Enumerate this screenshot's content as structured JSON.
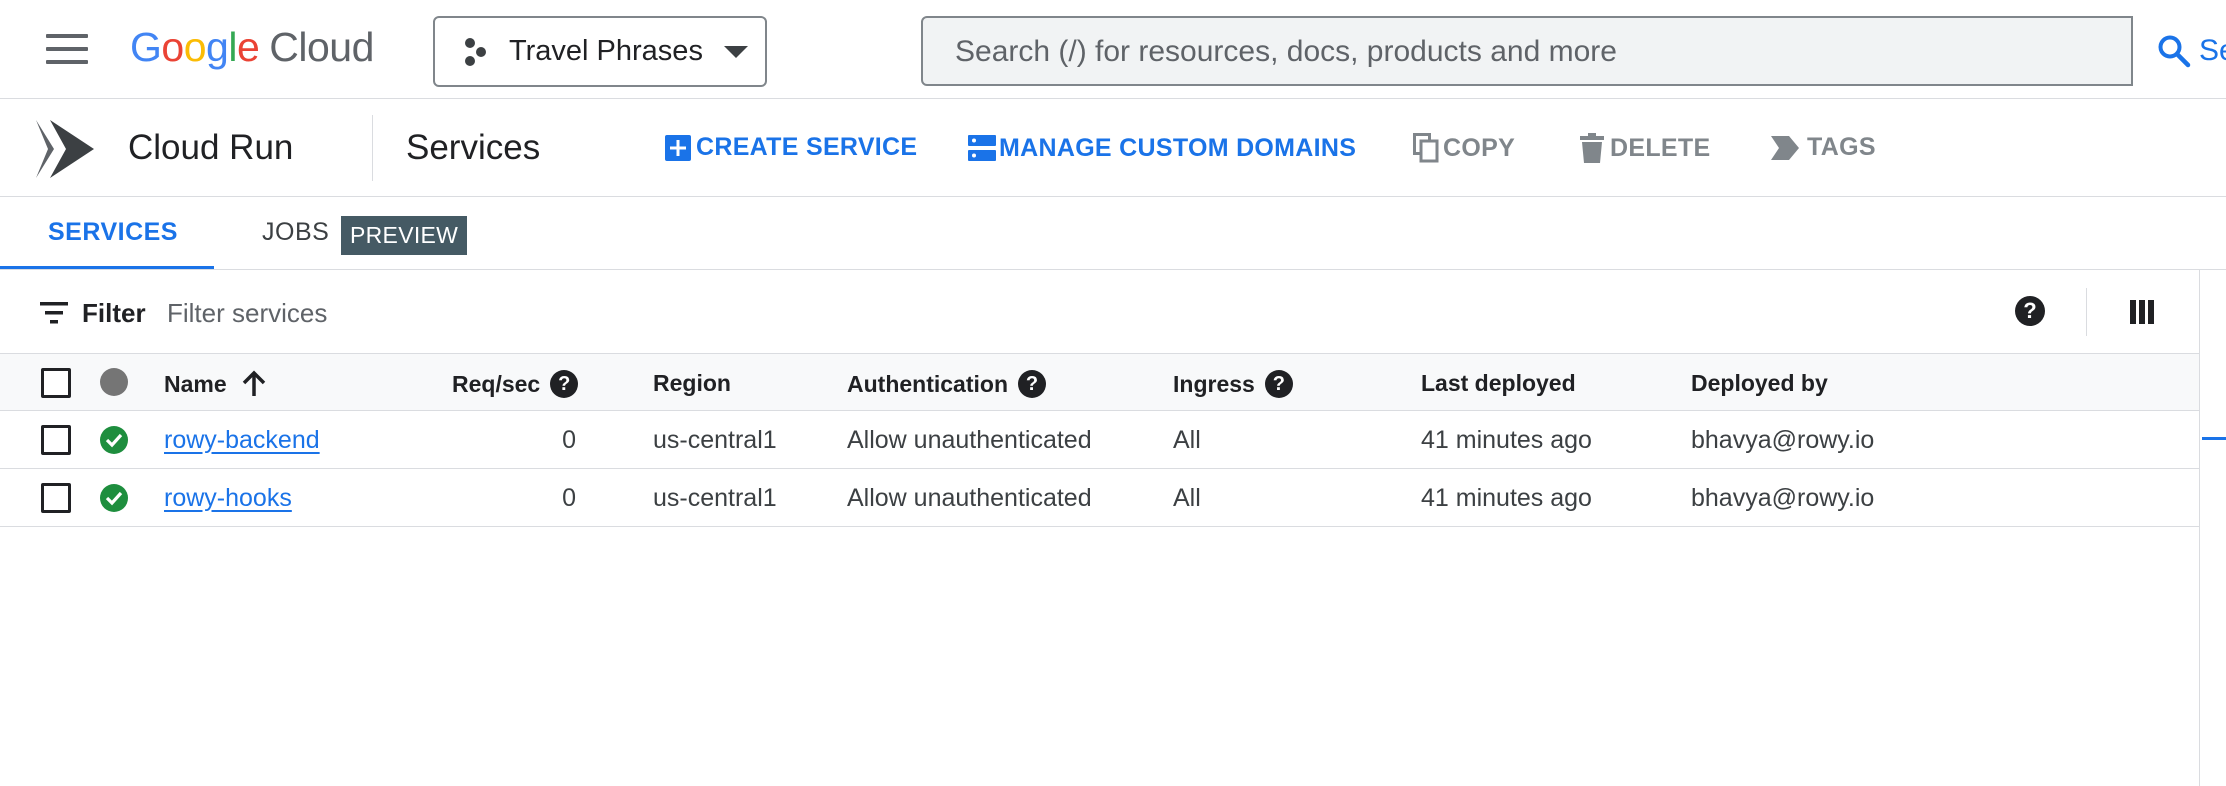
{
  "header": {
    "logo_letters": [
      {
        "ch": "G",
        "color": "#4285F4"
      },
      {
        "ch": "o",
        "color": "#EA4335"
      },
      {
        "ch": "o",
        "color": "#FBBC05"
      },
      {
        "ch": "g",
        "color": "#4285F4"
      },
      {
        "ch": "l",
        "color": "#34A853"
      },
      {
        "ch": "e",
        "color": "#EA4335"
      }
    ],
    "logo_suffix": "Cloud",
    "project_name": "Travel Phrases",
    "search_placeholder": "Search (/) for resources, docs, products and more",
    "search_button_label": "Se"
  },
  "product": {
    "name": "Cloud Run",
    "page_title": "Services"
  },
  "actions": {
    "create_service": "CREATE SERVICE",
    "manage_domains": "MANAGE CUSTOM DOMAINS",
    "copy": "COPY",
    "delete": "DELETE",
    "tags": "TAGS"
  },
  "tabs": {
    "services": "SERVICES",
    "jobs": "JOBS",
    "jobs_badge": "PREVIEW"
  },
  "filter": {
    "label": "Filter",
    "placeholder": "Filter services"
  },
  "table": {
    "headers": {
      "name": "Name",
      "req_sec": "Req/sec",
      "region": "Region",
      "authentication": "Authentication",
      "ingress": "Ingress",
      "last_deployed": "Last deployed",
      "deployed_by": "Deployed by"
    },
    "rows": [
      {
        "name": "rowy-backend",
        "req_sec": "0",
        "region": "us-central1",
        "authentication": "Allow unauthenticated",
        "ingress": "All",
        "last_deployed": "41 minutes ago",
        "deployed_by": "bhavya@rowy.io"
      },
      {
        "name": "rowy-hooks",
        "req_sec": "0",
        "region": "us-central1",
        "authentication": "Allow unauthenticated",
        "ingress": "All",
        "last_deployed": "41 minutes ago",
        "deployed_by": "bhavya@rowy.io"
      }
    ]
  },
  "colors": {
    "accent": "#1a73e8",
    "status_ok": "#1e8e3e",
    "preview_badge": "#455a64"
  }
}
